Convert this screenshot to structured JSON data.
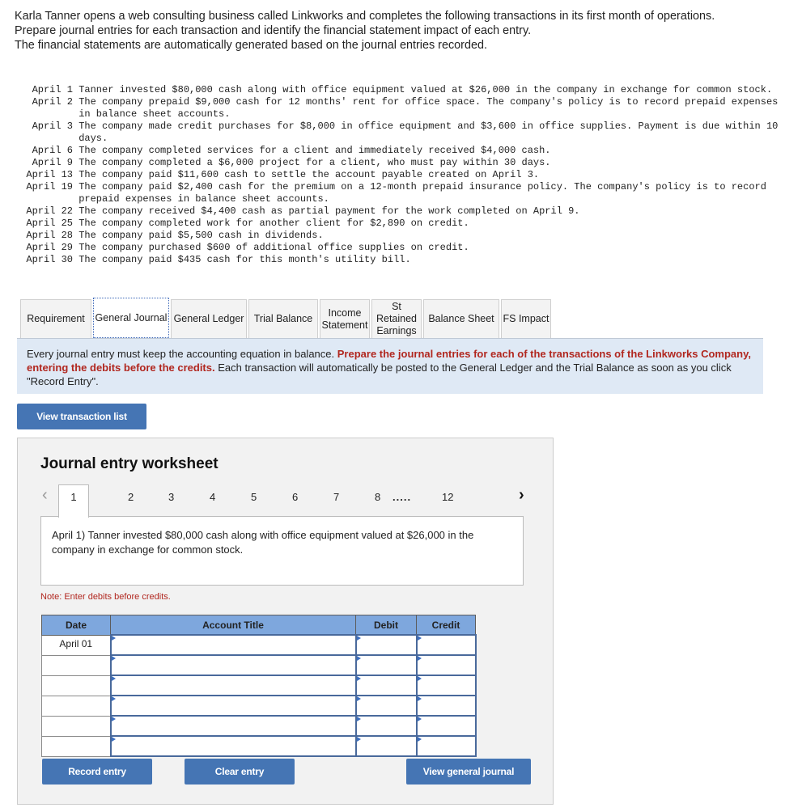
{
  "intro": {
    "line1": "Karla Tanner opens a web consulting business called Linkworks and completes the following transactions in its first month of operations.",
    "line2": "Prepare journal entries for each transaction and identify the financial statement impact of each entry.",
    "line3": "The financial statements are automatically generated based on the journal entries recorded."
  },
  "transactions": [
    {
      "date": "April 1",
      "text": "Tanner invested $80,000 cash along with office equipment valued at $26,000 in the company in exchange for common stock."
    },
    {
      "date": "April 2",
      "text": "The company prepaid $9,000 cash for 12 months' rent for office space. The company's policy is to record prepaid expenses in balance sheet accounts."
    },
    {
      "date": "April 3",
      "text": "The company made credit purchases for $8,000 in office equipment and $3,600 in office supplies. Payment is due within 10 days."
    },
    {
      "date": "April 6",
      "text": "The company completed services for a client and immediately received $4,000 cash."
    },
    {
      "date": "April 9",
      "text": "The company completed a $6,000 project for a client, who must pay within 30 days."
    },
    {
      "date": "April 13",
      "text": "The company paid $11,600 cash to settle the account payable created on April 3."
    },
    {
      "date": "April 19",
      "text": "The company paid $2,400 cash for the premium on a 12-month prepaid insurance policy. The company's policy is to record prepaid expenses in balance sheet accounts."
    },
    {
      "date": "April 22",
      "text": "The company received $4,400 cash as partial payment for the work completed on April 9."
    },
    {
      "date": "April 25",
      "text": "The company completed work for another client for $2,890 on credit."
    },
    {
      "date": "April 28",
      "text": "The company paid $5,500 cash in dividends."
    },
    {
      "date": "April 29",
      "text": "The company purchased $600 of additional office supplies on credit."
    },
    {
      "date": "April 30",
      "text": "The company paid $435 cash for this month's utility bill."
    }
  ],
  "tabs": [
    {
      "label": "Requirement",
      "active": false
    },
    {
      "label": "General Journal",
      "active": true
    },
    {
      "label": "General Ledger",
      "active": false
    },
    {
      "label": "Trial Balance",
      "active": false
    },
    {
      "label": "Income Statement",
      "active": false
    },
    {
      "label": "St Retained Earnings",
      "active": false
    },
    {
      "label": "Balance Sheet",
      "active": false
    },
    {
      "label": "FS Impact",
      "active": false
    }
  ],
  "banner": {
    "plain1": "Every journal entry must keep the accounting equation in balance. ",
    "emphasis": "Prepare the journal entries for each of the transactions of the Linkworks Company, entering the debits before the credits.",
    "plain2": " Each transaction will automatically be posted to the General Ledger and the Trial Balance as soon as you click \"Record Entry\"."
  },
  "buttons": {
    "view_transaction_list": "View transaction list",
    "record_entry": "Record entry",
    "clear_entry": "Clear entry",
    "view_general_journal": "View general journal"
  },
  "worksheet": {
    "title": "Journal entry worksheet",
    "pages": [
      "1",
      "2",
      "3",
      "4",
      "5",
      "6",
      "7",
      "8",
      ".....",
      "12"
    ],
    "current_page": "1",
    "prev_icon": "‹",
    "next_icon": "›",
    "description": "April 1) Tanner invested $80,000 cash along with office equipment valued at $26,000 in the company in exchange for common stock.",
    "note": "Note: Enter debits before credits.",
    "columns": [
      "Date",
      "Account Title",
      "Debit",
      "Credit"
    ],
    "rows": [
      {
        "date": "April 01",
        "account": "",
        "debit": "",
        "credit": ""
      },
      {
        "date": "",
        "account": "",
        "debit": "",
        "credit": ""
      },
      {
        "date": "",
        "account": "",
        "debit": "",
        "credit": ""
      },
      {
        "date": "",
        "account": "",
        "debit": "",
        "credit": ""
      },
      {
        "date": "",
        "account": "",
        "debit": "",
        "credit": ""
      },
      {
        "date": "",
        "account": "",
        "debit": "",
        "credit": ""
      }
    ]
  },
  "colors": {
    "accent_button": "#4575b4",
    "emphasis_red": "#b1271f",
    "table_header": "#7ea7dd",
    "banner_bg": "#dfe9f5"
  }
}
